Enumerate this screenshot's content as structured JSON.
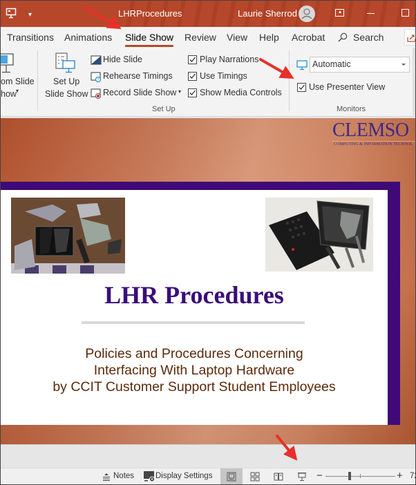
{
  "window": {
    "title": "LHRProcedures",
    "user_name": "Laurie Sherrod",
    "icons": [
      "presentation-app-icon",
      "quick-access-dropdown-icon",
      "user-avatar-icon",
      "ribbon-display-options-icon",
      "minimize-icon",
      "maximize-icon"
    ]
  },
  "tabs": [
    {
      "label": "Transitions",
      "active": false
    },
    {
      "label": "Animations",
      "active": false
    },
    {
      "label": "Slide Show",
      "active": true
    },
    {
      "label": "Review",
      "active": false
    },
    {
      "label": "View",
      "active": false
    },
    {
      "label": "Help",
      "active": false
    },
    {
      "label": "Acrobat",
      "active": false
    }
  ],
  "search": {
    "label": "Search"
  },
  "ribbon": {
    "start_group": {
      "custom_slide_show_line1": "om Slide",
      "custom_slide_show_line2": "how"
    },
    "setup_group": {
      "label": "Set Up",
      "setup_button_line1": "Set Up",
      "setup_button_line2": "Slide Show",
      "hide_slide": "Hide Slide",
      "rehearse_timings": "Rehearse Timings",
      "record_slide_show": "Record Slide Show",
      "checkboxes": [
        {
          "label": "Play Narrations",
          "checked": true
        },
        {
          "label": "Use Timings",
          "checked": true
        },
        {
          "label": "Show Media Controls",
          "checked": true
        }
      ]
    },
    "monitors_group": {
      "label": "Monitors",
      "monitor_select": "Automatic",
      "use_presenter_view": {
        "label": "Use Presenter View",
        "checked": true
      }
    }
  },
  "slide": {
    "logo_text": "CLEMSO",
    "logo_subtext": "COMPUTING & INFORMATION TECHNOL",
    "title": "LHR Procedures",
    "subtitle_lines": [
      "Policies and Procedures Concerning",
      "Interfacing With Laptop Hardware",
      "by CCIT Customer Support Student Employees"
    ],
    "images": [
      "disassembled-laptop-parts-photo",
      "broken-laptop-photo"
    ]
  },
  "statusbar": {
    "notes": "Notes",
    "display_settings": "Display Settings",
    "views": [
      "normal-view",
      "slide-sorter-view",
      "reading-view",
      "slide-show-view"
    ],
    "active_view": "normal-view",
    "zoom_label": "72"
  },
  "colors": {
    "accent": "#b7472a",
    "slide_title": "#3a0d7a",
    "slide_frame": "#3f0a78",
    "subtitle": "#5b2a0a",
    "annotation_arrow": "#e8302a"
  }
}
